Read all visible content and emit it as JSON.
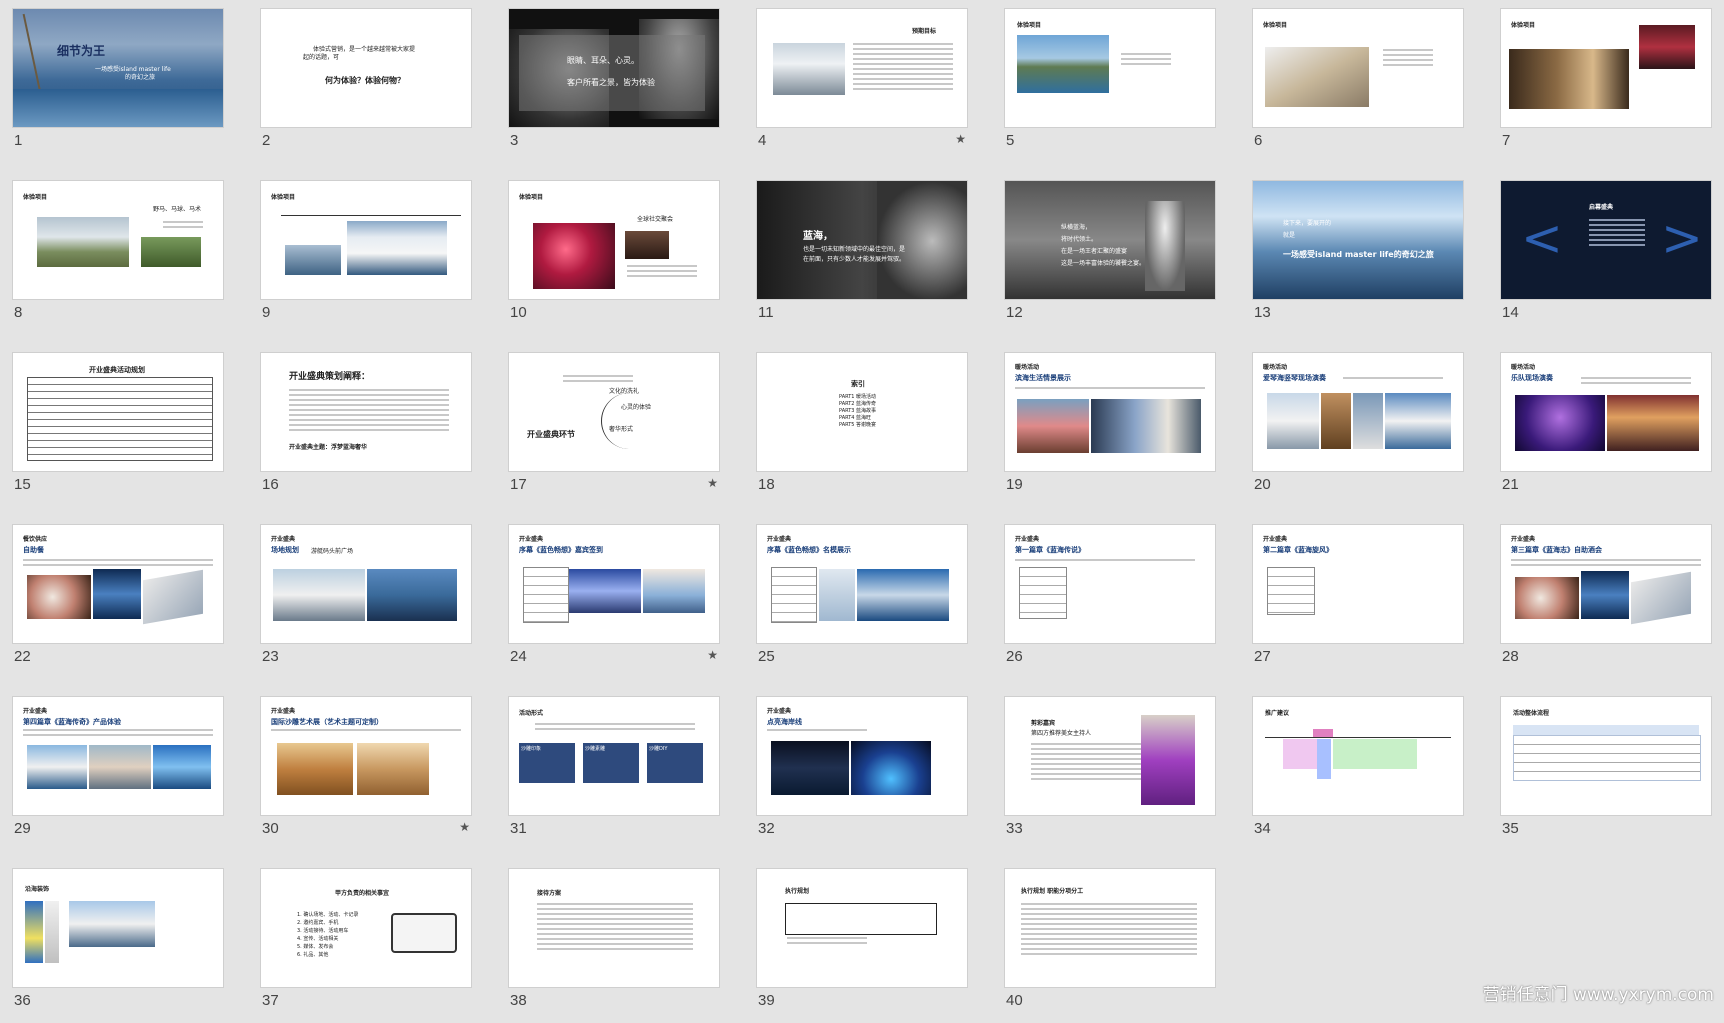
{
  "slides": [
    {
      "n": "1",
      "star": "",
      "title": "细节为王",
      "sub": "一场感受island master life",
      "sub2": "的奇幻之旅"
    },
    {
      "n": "2",
      "star": "",
      "l1": "体验式营销，是一个越来越常被大家提",
      "l2": "起的话题，可",
      "l3": "何为体验？体验何物？"
    },
    {
      "n": "3",
      "star": "",
      "l1": "眼睛、耳朵、心灵。",
      "l2": "客户所看之景，皆为体验"
    },
    {
      "n": "4",
      "star": "★",
      "title": "预期目标"
    },
    {
      "n": "5",
      "star": "",
      "title": "体验项目"
    },
    {
      "n": "6",
      "star": "",
      "title": "体验项目"
    },
    {
      "n": "7",
      "star": "",
      "title": "体验项目"
    },
    {
      "n": "8",
      "star": "",
      "title": "体验项目",
      "sub": "野马、马球、马术"
    },
    {
      "n": "9",
      "star": "",
      "title": "体验项目"
    },
    {
      "n": "10",
      "star": "",
      "title": "体验项目",
      "sub": "全球社交聚会"
    },
    {
      "n": "11",
      "star": "",
      "l1": "蓝海，",
      "l2": "也是一切未知新领域中的最佳空间，是",
      "l3": "在前面，只有少数人才能发展并驾驭。"
    },
    {
      "n": "12",
      "star": "",
      "l1": "纵横蓝海，",
      "l2": "将时代领土。",
      "l3": "在是一场王者汇聚的盛宴",
      "l4": "这是一场丰富体验的饕餮之宴。"
    },
    {
      "n": "13",
      "star": "",
      "l1": "接下来，要展开的",
      "l2": "就是",
      "l3": "一场感受island master life的奇幻之旅"
    },
    {
      "n": "14",
      "star": "",
      "title": "启幕盛典"
    },
    {
      "n": "15",
      "star": "",
      "title": "开业盛典活动规划"
    },
    {
      "n": "16",
      "star": "",
      "title": "开业盛典策划阐释：",
      "f": "开业盛典主题：浮梦蓝海奢华"
    },
    {
      "n": "17",
      "star": "★",
      "title": "开业盛典环节",
      "a": "文化的洗礼",
      "b": "心灵的体验",
      "c": "奢华形式"
    },
    {
      "n": "18",
      "star": "",
      "title": "索引",
      "items": [
        "PART1 暖场活动",
        "PART2 蓝海传奇",
        "PART3 蓝海故事",
        "PART4 蓝海旺",
        "PART5 答谢晚宴"
      ]
    },
    {
      "n": "19",
      "star": "",
      "tag": "暖场活动",
      "title": "滨海生活情景展示"
    },
    {
      "n": "20",
      "star": "",
      "tag": "暖场活动",
      "title": "爱琴海竖琴现场演奏"
    },
    {
      "n": "21",
      "star": "",
      "tag": "暖场活动",
      "title": "乐队现场演奏"
    },
    {
      "n": "22",
      "star": "",
      "tag": "餐饮供应",
      "title": "自助餐"
    },
    {
      "n": "23",
      "star": "",
      "tag": "开业盛典",
      "title": "场地规划",
      "sub": "游艇码头前广场"
    },
    {
      "n": "24",
      "star": "★",
      "tag": "开业盛典",
      "title": "序幕《蓝色畅想》嘉宾签到"
    },
    {
      "n": "25",
      "star": "",
      "tag": "开业盛典",
      "title": "序幕《蓝色畅想》名模展示"
    },
    {
      "n": "26",
      "star": "",
      "tag": "开业盛典",
      "title": "第一篇章《蓝海传说》"
    },
    {
      "n": "27",
      "star": "",
      "tag": "开业盛典",
      "title": "第二篇章《蓝海旋风》"
    },
    {
      "n": "28",
      "star": "",
      "tag": "开业盛典",
      "title": "第三篇章《蓝海志》自助酒会"
    },
    {
      "n": "29",
      "star": "",
      "tag": "开业盛典",
      "title": "第四篇章《蓝海传奇》产品体验"
    },
    {
      "n": "30",
      "star": "★",
      "tag": "开业盛典",
      "title": "国际沙雕艺术展（艺术主题可定制）"
    },
    {
      "n": "31",
      "star": "",
      "title": "活动形式",
      "boxes": [
        "沙雕印象",
        "沙雕素雕",
        "沙雕DIY"
      ]
    },
    {
      "n": "32",
      "star": "",
      "tag": "开业盛典",
      "title": "点亮海岸线"
    },
    {
      "n": "33",
      "star": "",
      "title": "剪彩嘉宾",
      "sub": "第四方推荐美女主持人"
    },
    {
      "n": "34",
      "star": "",
      "title": "推广建议"
    },
    {
      "n": "35",
      "star": "",
      "title": "活动整体流程"
    },
    {
      "n": "36",
      "star": "",
      "title": "沿海装饰"
    },
    {
      "n": "37",
      "star": "",
      "title": "甲方负责的相关事宜",
      "items": [
        "1. 确认场地、活动、卡记录",
        "2. 邀约嘉宾、手机",
        "3. 活动接待、活动用车",
        "4. 宣传、活动相关",
        "5. 媒体、发布会",
        "6. 礼品、其他"
      ]
    },
    {
      "n": "38",
      "star": "",
      "title": "接待方案"
    },
    {
      "n": "39",
      "star": "",
      "title": "执行规划"
    },
    {
      "n": "40",
      "star": "",
      "title": "执行规划 职能分项分工"
    }
  ],
  "watermark": "营销任意门 www.yxrym.com"
}
